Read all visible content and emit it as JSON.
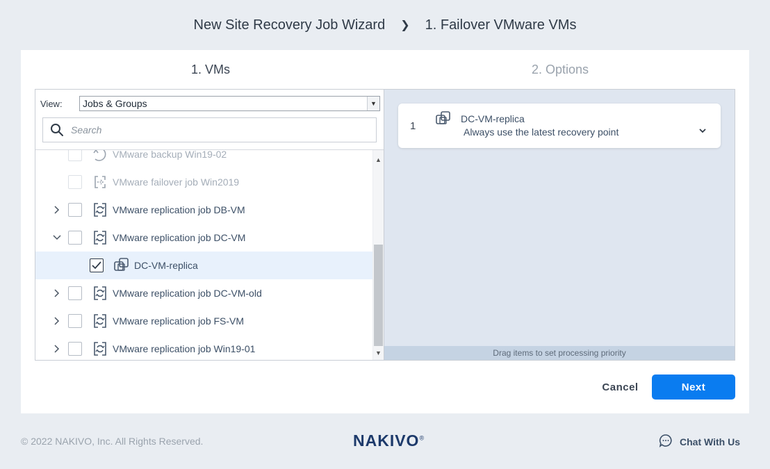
{
  "header": {
    "wizard_title": "New Site Recovery Job Wizard",
    "separator": "❯",
    "step_title": "1. Failover VMware VMs"
  },
  "steps": [
    {
      "label": "1. VMs",
      "state": "active"
    },
    {
      "label": "2. Options",
      "state": "inactive"
    }
  ],
  "left": {
    "view_label": "View:",
    "view_value": "Jobs & Groups",
    "search_placeholder": "Search",
    "tree": [
      {
        "label": "VMware backup Win19-02",
        "type": "backup-job",
        "faded": true,
        "expander": "",
        "checked": false
      },
      {
        "label": "VMware failover job Win2019",
        "type": "failover-job",
        "faded": true,
        "expander": "",
        "checked": false
      },
      {
        "label": "VMware replication job DB-VM",
        "type": "replication-job",
        "faded": false,
        "expander": "collapsed",
        "checked": false
      },
      {
        "label": "VMware replication job DC-VM",
        "type": "replication-job",
        "faded": false,
        "expander": "expanded",
        "checked": false
      },
      {
        "label": "DC-VM-replica",
        "type": "vm-replica",
        "faded": false,
        "expander": "",
        "checked": true
      },
      {
        "label": "VMware replication job DC-VM-old",
        "type": "replication-job",
        "faded": false,
        "expander": "collapsed",
        "checked": false
      },
      {
        "label": "VMware replication job FS-VM",
        "type": "replication-job",
        "faded": false,
        "expander": "collapsed",
        "checked": false
      },
      {
        "label": "VMware replication job Win19-01",
        "type": "replication-job",
        "faded": false,
        "expander": "collapsed",
        "checked": false
      }
    ]
  },
  "right": {
    "items": [
      {
        "index": "1",
        "name": "DC-VM-replica",
        "subtitle": "Always use the latest recovery point"
      }
    ],
    "drag_hint": "Drag items to set processing priority"
  },
  "actions": {
    "cancel": "Cancel",
    "next": "Next"
  },
  "footer": {
    "copyright": "© 2022 NAKIVO, Inc. All Rights Reserved.",
    "logo": "NAKIVO",
    "logo_mark": "®",
    "chat": "Chat With Us"
  },
  "colors": {
    "accent": "#0a7cf0",
    "selected_row": "#e8f1fc",
    "right_pane_bg": "#dfe6f0",
    "logo": "#1d3a6b"
  }
}
